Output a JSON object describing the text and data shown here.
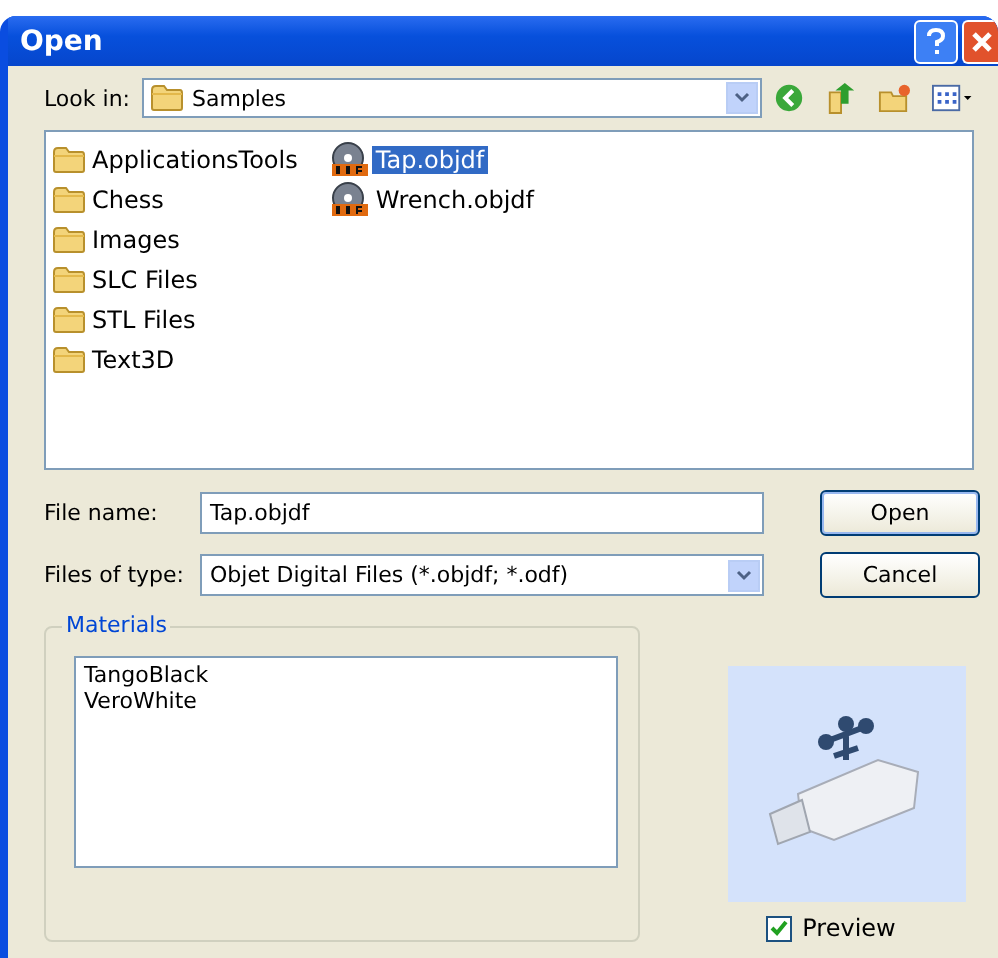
{
  "window": {
    "title": "Open"
  },
  "look_in": {
    "label": "Look in:",
    "value": "Samples"
  },
  "files": [
    {
      "name": "ApplicationsTools",
      "kind": "folder",
      "selected": false
    },
    {
      "name": "Chess",
      "kind": "folder",
      "selected": false
    },
    {
      "name": "Images",
      "kind": "folder",
      "selected": false
    },
    {
      "name": "SLC Files",
      "kind": "folder",
      "selected": false
    },
    {
      "name": "STL Files",
      "kind": "folder",
      "selected": false
    },
    {
      "name": "Text3D",
      "kind": "folder",
      "selected": false
    },
    {
      "name": "Tap.objdf",
      "kind": "file",
      "selected": true
    },
    {
      "name": "Wrench.objdf",
      "kind": "file",
      "selected": false
    }
  ],
  "file_name": {
    "label": "File name:",
    "value": "Tap.objdf"
  },
  "file_type": {
    "label": "Files of type:",
    "value": "Objet Digital Files (*.objdf; *.odf)"
  },
  "buttons": [
    "Open",
    "Cancel"
  ],
  "materials": {
    "title": "Materials",
    "items": [
      "TangoBlack",
      "VeroWhite"
    ]
  },
  "preview": {
    "label": "Preview",
    "checked": true
  }
}
